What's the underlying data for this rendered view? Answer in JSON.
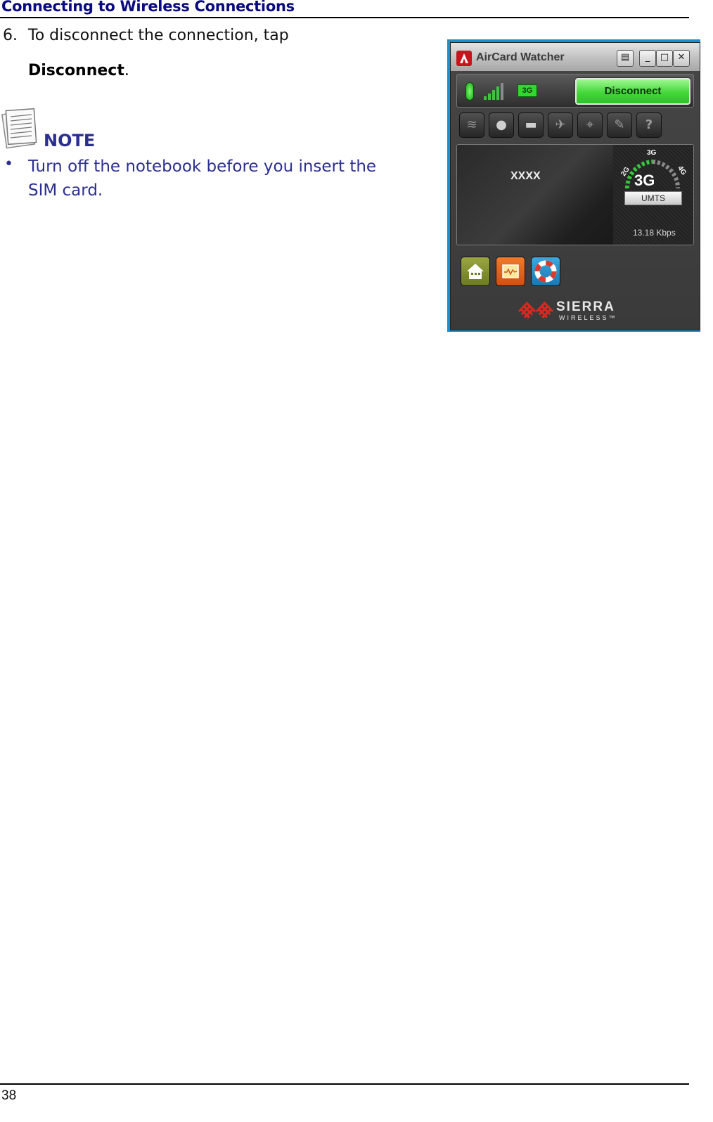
{
  "header": {
    "title": "Connecting to Wireless Connections"
  },
  "step": {
    "number": "6.",
    "text": "To disconnect the connection, tap",
    "bold_term": "Disconnect",
    "suffix": "."
  },
  "note": {
    "icon": "note-paper-icon",
    "label": "NOTE",
    "bullet": "•",
    "items": [
      "Turn off the notebook before you insert the SIM card."
    ]
  },
  "aircard_window": {
    "title": "AirCard Watcher",
    "window_buttons": [
      {
        "name": "menu",
        "glyph": "▤"
      },
      {
        "name": "minimize",
        "glyph": "_"
      },
      {
        "name": "maximize",
        "glyph": "□"
      },
      {
        "name": "close",
        "glyph": "✕"
      }
    ],
    "status": {
      "led_state": "connected",
      "signal_bars": 5,
      "signal_bars_lit": 4,
      "network_badge": "3G",
      "accent_green": "#3bc63b"
    },
    "disconnect_label": "Disconnect",
    "toolbar": [
      {
        "name": "wifi",
        "glyph": "≋"
      },
      {
        "name": "messages",
        "glyph": "●"
      },
      {
        "name": "device",
        "glyph": "▬"
      },
      {
        "name": "airplane",
        "glyph": "✈"
      },
      {
        "name": "gps",
        "glyph": "⌖"
      },
      {
        "name": "settings-wrench",
        "glyph": "✎"
      },
      {
        "name": "help",
        "glyph": "?"
      }
    ],
    "carrier": "XXXX",
    "gauge": {
      "labels": [
        "2G",
        "3G",
        "4G"
      ],
      "current": "3G",
      "technology": "UMTS"
    },
    "speed": "13.18 Kbps",
    "app_buttons": [
      {
        "name": "home",
        "color": "#7d8a2c"
      },
      {
        "name": "activity-monitor",
        "color": "#e0621c"
      },
      {
        "name": "help-lifebuoy",
        "color": "#2490c8"
      }
    ],
    "brand": {
      "name": "SIERRA",
      "sub": "WIRELESS™"
    }
  },
  "footer": {
    "page_number": "38"
  }
}
